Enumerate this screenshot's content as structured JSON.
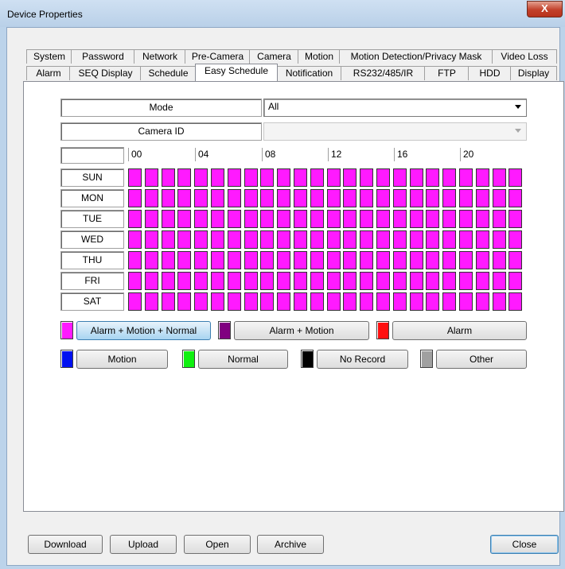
{
  "window": {
    "title": "Device Properties",
    "close_glyph": "X"
  },
  "tabs_row1": [
    "System",
    "Password",
    "Network",
    "Pre-Camera",
    "Camera",
    "Motion",
    "Motion Detection/Privacy Mask",
    "Video Loss"
  ],
  "tabs_row2": [
    "Alarm",
    "SEQ Display",
    "Schedule",
    "Easy Schedule",
    "Notification",
    "RS232/485/IR",
    "FTP",
    "HDD",
    "Display"
  ],
  "active_tab": "Easy Schedule",
  "mode": {
    "label": "Mode",
    "value": "All"
  },
  "camera_id": {
    "label": "Camera ID",
    "value": ""
  },
  "hours": [
    "00",
    "04",
    "08",
    "12",
    "16",
    "20"
  ],
  "days": [
    "SUN",
    "MON",
    "TUE",
    "WED",
    "THU",
    "FRI",
    "SAT"
  ],
  "schedule": {
    "slots_per_day": 24,
    "fill_mode": "Alarm + Motion + Normal"
  },
  "legend": [
    {
      "label": "Alarm + Motion + Normal",
      "color": "#ff1aff",
      "selected": true
    },
    {
      "label": "Alarm + Motion",
      "color": "#800080",
      "selected": false
    },
    {
      "label": "Alarm",
      "color": "#ff1010",
      "selected": false
    },
    {
      "label": "Motion",
      "color": "#0010f0",
      "selected": false
    },
    {
      "label": "Normal",
      "color": "#10f010",
      "selected": false
    },
    {
      "label": "No Record",
      "color": "#000000",
      "selected": false
    },
    {
      "label": "Other",
      "color": "#a0a0a0",
      "selected": false
    }
  ],
  "footer": {
    "download": "Download",
    "upload": "Upload",
    "open": "Open",
    "archive": "Archive",
    "close": "Close"
  }
}
